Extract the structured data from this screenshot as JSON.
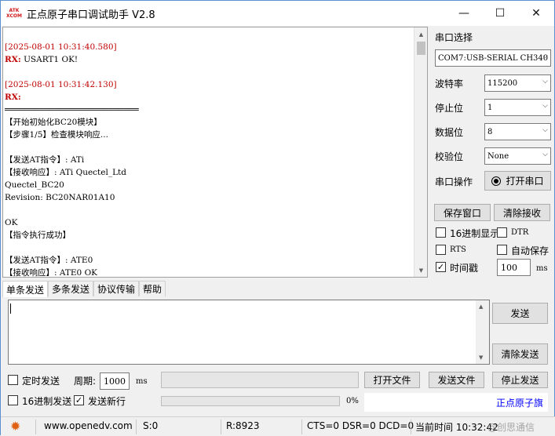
{
  "window": {
    "title": "正点原子串口调试助手 V2.8",
    "logo_top": "ATK",
    "logo_bottom": "XCOM",
    "minimize": "—",
    "maximize": "☐",
    "close": "✕"
  },
  "receive": {
    "lines": [
      {
        "text": "[2025-08-01 10:31:40.580]",
        "style": "red"
      },
      {
        "text": "RX:",
        "style": "rx",
        "rest": " USART1 OK!"
      },
      {
        "text": "",
        "style": "blk"
      },
      {
        "text": "[2025-08-01 10:31:42.130]",
        "style": "red"
      },
      {
        "text": "RX:",
        "style": "rx",
        "rest": ""
      },
      {
        "text": "═══════════════════════════",
        "style": "blk"
      },
      {
        "text": "【开始初始化BC20模块】",
        "style": "blk"
      },
      {
        "text": "【步骤1/5】检查模块响应...",
        "style": "blk"
      },
      {
        "text": "",
        "style": "blk"
      },
      {
        "text": "【发送AT指令】: ATi",
        "style": "blk"
      },
      {
        "text": "【接收响应】: ATi Quectel_Ltd",
        "style": "blk"
      },
      {
        "text": "Quectel_BC20",
        "style": "blk"
      },
      {
        "text": "Revision: BC20NAR01A10",
        "style": "blk"
      },
      {
        "text": "",
        "style": "blk"
      },
      {
        "text": "OK",
        "style": "blk"
      },
      {
        "text": "【指令执行成功】",
        "style": "blk"
      },
      {
        "text": "",
        "style": "blk"
      },
      {
        "text": "【发送AT指令】: ATE0",
        "style": "blk"
      },
      {
        "text": "【接收响应】: ATE0 OK",
        "style": "blk"
      }
    ]
  },
  "serial": {
    "port_select_label": "串口选择",
    "port_value": "COM7:USB-SERIAL CH340",
    "baud_label": "波特率",
    "baud_value": "115200",
    "stop_label": "停止位",
    "stop_value": "1",
    "data_label": "数据位",
    "data_value": "8",
    "parity_label": "校验位",
    "parity_value": "None",
    "op_label": "串口操作",
    "open_button": "打开串口"
  },
  "side_buttons": {
    "save_window": "保存窗口",
    "clear_receive": "清除接收"
  },
  "options": {
    "hex_display": "16进制显示",
    "dtr": "DTR",
    "rts": "RTS",
    "auto_save": "自动保存",
    "timestamp": "时间戳",
    "timestamp_checked": true,
    "timestamp_value": "100",
    "timestamp_unit": "ms"
  },
  "tabs": [
    "单条发送",
    "多条发送",
    "协议传输",
    "帮助"
  ],
  "send_panel": {
    "send_button": "发送",
    "clear_send_button": "清除发送",
    "timed_send": "定时发送",
    "period_label": "周期:",
    "period_value": "1000",
    "period_unit": "ms",
    "open_file": "打开文件",
    "send_file": "发送文件",
    "stop_send": "停止发送",
    "hex_send": "16进制发送",
    "send_newline": "发送新行",
    "send_newline_checked": true,
    "progress_percent": "0%",
    "brand_link": "正点原子旗"
  },
  "status_bar": {
    "website": "www.openedv.com",
    "sent": "S:0",
    "received": "R:8923",
    "lines": "CTS=0 DSR=0 DCD=0",
    "time": "当前时间 10:32:42",
    "watermark": "@创思通信"
  },
  "colors": {
    "timestamp": "#c00000",
    "brand_link": "#0000ff",
    "gear": "#e06010"
  }
}
